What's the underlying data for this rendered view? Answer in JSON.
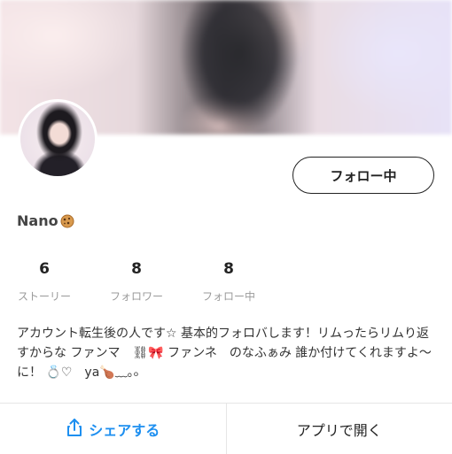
{
  "profile": {
    "name": "Nano",
    "follow_button_label": "フォロー中",
    "bio": "アカウント転生後の人です☆ 基本的フォロバします！リムったらリムり返すからな ファンマ　⛓🎀 ファンネ　のなふぁみ 誰か付けてくれますよ〜に！ 💍♡　ya🍗﹏｡ₒ"
  },
  "stats": [
    {
      "value": "6",
      "label": "ストーリー"
    },
    {
      "value": "8",
      "label": "フォロワー"
    },
    {
      "value": "8",
      "label": "フォロー中"
    }
  ],
  "bottom_bar": {
    "share_label": "シェアする",
    "open_app_label": "アプリで開く"
  },
  "colors": {
    "accent": "#1d8ff0",
    "text": "#222222",
    "muted": "#9a9a9a"
  },
  "icons": {
    "name_badge": "cookie-icon",
    "share": "share-icon"
  }
}
